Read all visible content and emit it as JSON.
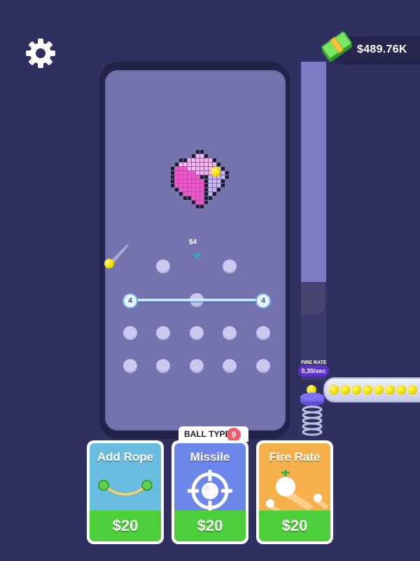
{
  "hud": {
    "money": "$489.76K"
  },
  "board": {
    "price_label": "$4",
    "rope_left_value": "4",
    "rope_right_value": "4",
    "fire_rate_title": "FIRE RATE",
    "fire_rate_value": "0,30/sec"
  },
  "ball_type": {
    "label": "BALL TYPE",
    "count": "9"
  },
  "cards": [
    {
      "title": "Add Rope",
      "price": "$20",
      "color": "#69bde0",
      "icon": "rope-icon"
    },
    {
      "title": "Missile",
      "price": "$20",
      "color": "#6d86ea",
      "icon": "crosshair-icon"
    },
    {
      "title": "Fire Rate",
      "price": "$20",
      "color": "#f5b04c",
      "icon": "speed-ball-icon"
    }
  ],
  "colors": {
    "background": "#2f2f60",
    "board": "#7473ae",
    "ball": "#f0dd00",
    "price_green": "#4ccf3a"
  }
}
